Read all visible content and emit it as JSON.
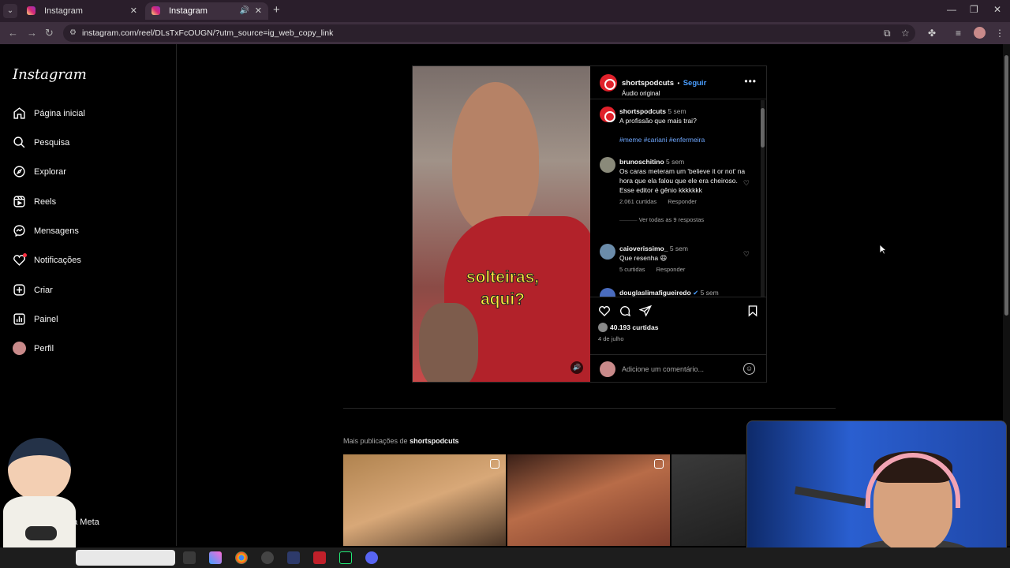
{
  "browser": {
    "tabs": [
      {
        "title": "Instagram",
        "active": false
      },
      {
        "title": "Instagram",
        "active": true
      }
    ],
    "url": "instagram.com/reel/DLsTxFcOUGN/?utm_source=ig_web_copy_link"
  },
  "sidebar": {
    "logo": "Instagram",
    "items": [
      {
        "label": "Página inicial",
        "icon": "home-icon"
      },
      {
        "label": "Pesquisa",
        "icon": "search-icon"
      },
      {
        "label": "Explorar",
        "icon": "compass-icon"
      },
      {
        "label": "Reels",
        "icon": "reels-icon"
      },
      {
        "label": "Mensagens",
        "icon": "messenger-icon"
      },
      {
        "label": "Notificações",
        "icon": "heart-icon"
      },
      {
        "label": "Criar",
        "icon": "plus-square-icon"
      },
      {
        "label": "Painel",
        "icon": "dashboard-icon"
      },
      {
        "label": "Perfil",
        "icon": "avatar"
      }
    ],
    "footer_partial": "da Meta"
  },
  "post": {
    "video_caption": "solteiras,\naqui?",
    "author": "shortspodcuts",
    "follow": "Seguir",
    "separator": "•",
    "audio": "Áudio original",
    "caption": {
      "user": "shortspodcuts",
      "time": "5 sem",
      "text": "A profissão que mais trai?",
      "tags": "#meme #cariani #enfermeira"
    },
    "comments": [
      {
        "user": "brunoschitino",
        "time": "5 sem",
        "text": "Os caras meteram um 'believe it or not' na hora que ela falou que ele era cheiroso. Esse editor é gênio kkkkkkk",
        "likes": "2.061 curtidas",
        "reply": "Responder",
        "view_replies": "Ver todas as 9 respostas"
      },
      {
        "user": "caioverissimo_",
        "time": "5 sem",
        "text": "Que resenha 😆",
        "likes": "5 curtidas",
        "reply": "Responder"
      },
      {
        "user": "douglaslimafigueiredo",
        "time": "5 sem",
        "verified": true
      }
    ],
    "likes_total": "40.193 curtidas",
    "date": "4 de julho",
    "add_comment_placeholder": "Adicione um comentário..."
  },
  "more_posts": {
    "prefix": "Mais publicações de",
    "user": "shortspodcuts"
  },
  "colors": {
    "accent_link": "#4a9eff",
    "background": "#000000",
    "caption_yellow": "#ffeb3b",
    "notification_red": "#ff3040"
  }
}
